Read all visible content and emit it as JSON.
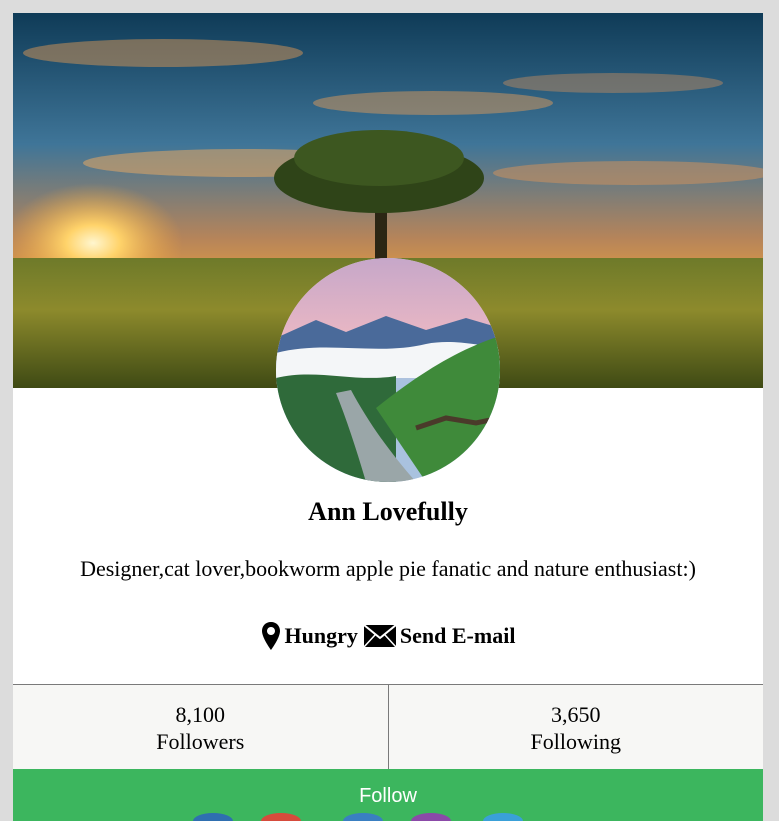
{
  "profile": {
    "name": "Ann Lovefully",
    "bio": "Designer,cat lover,bookworm apple pie fanatic and nature enthusiast:)",
    "location": "Hungry",
    "email_label": "Send E-mail"
  },
  "stats": [
    {
      "value": "8,100",
      "label": "Followers"
    },
    {
      "value": "3,650",
      "label": "Following"
    }
  ],
  "follow_label": "Follow",
  "colors": {
    "follow_button": "#3cb65e",
    "stats_background": "#f7f7f5",
    "page_background": "#dcdcdc"
  },
  "icons": {
    "location": "map-marker-icon",
    "email": "envelope-icon"
  }
}
